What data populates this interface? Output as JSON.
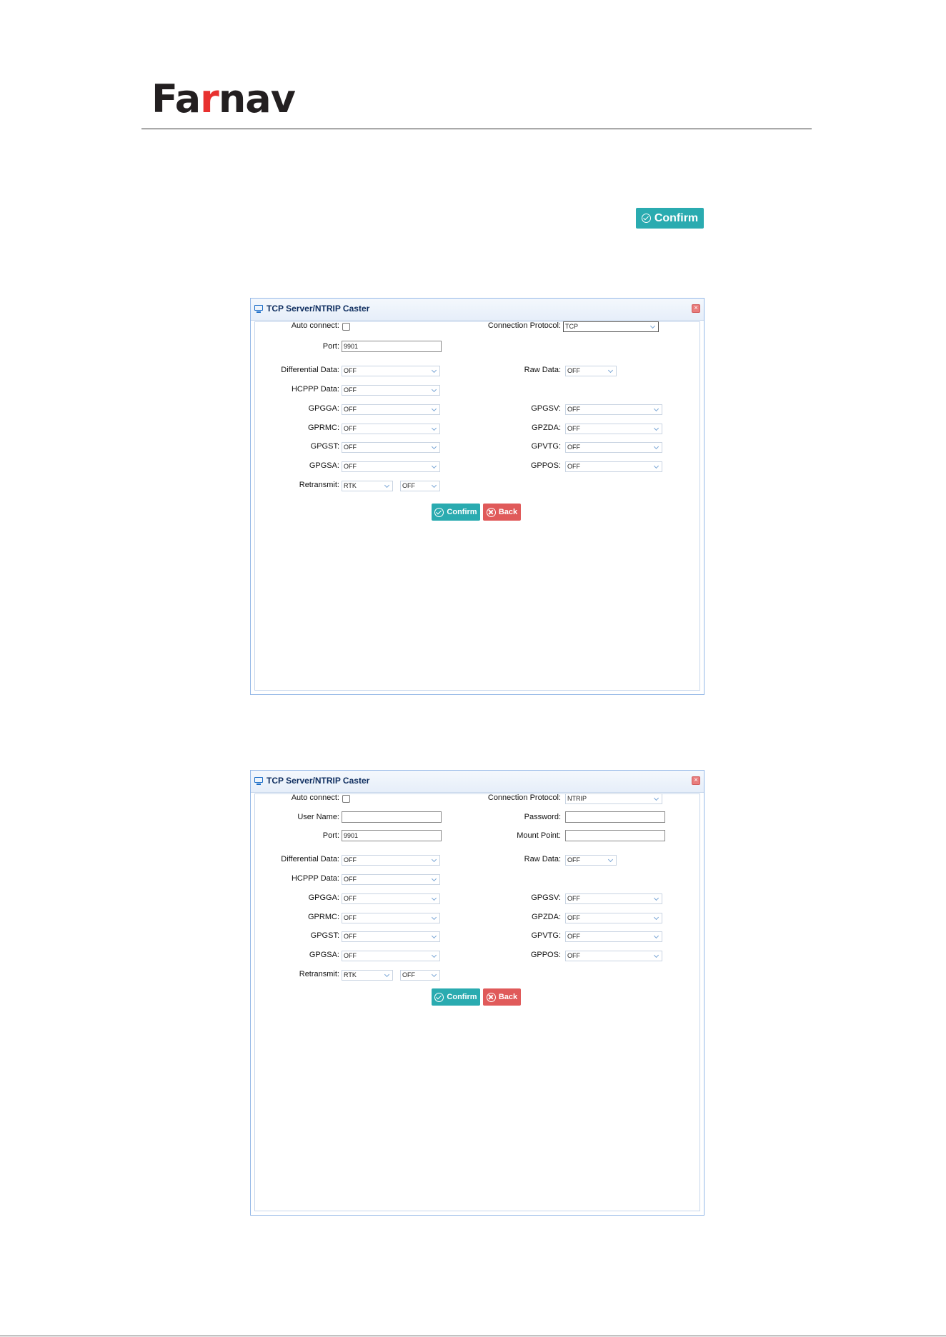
{
  "logo": {
    "part1": "Fa",
    "part2": "r",
    "part3": "nav"
  },
  "top_confirm": {
    "label": "Confirm"
  },
  "dialog1": {
    "title": "TCP Server/NTRIP Caster",
    "auto_connect_label": "Auto connect:",
    "protocol_label": "Connection Protocol:",
    "protocol_value": "TCP",
    "port_label": "Port:",
    "port_value": "9901",
    "diff_label": "Differential Data:",
    "diff_value": "OFF",
    "raw_label": "Raw Data:",
    "raw_value": "OFF",
    "hcppp_label": "HCPPP Data:",
    "hcppp_value": "OFF",
    "gpgga_label": "GPGGA:",
    "gpgga_value": "OFF",
    "gpgsv_label": "GPGSV:",
    "gpgsv_value": "OFF",
    "gprmc_label": "GPRMC:",
    "gprmc_value": "OFF",
    "gpzda_label": "GPZDA:",
    "gpzda_value": "OFF",
    "gpgst_label": "GPGST:",
    "gpgst_value": "OFF",
    "gpvtg_label": "GPVTG:",
    "gpvtg_value": "OFF",
    "gpgsa_label": "GPGSA:",
    "gpgsa_value": "OFF",
    "gppos_label": "GPPOS:",
    "gppos_value": "OFF",
    "retransmit_label": "Retransmit:",
    "retransmit_value1": "RTK",
    "retransmit_value2": "OFF",
    "confirm_label": "Confirm",
    "back_label": "Back"
  },
  "dialog2": {
    "title": "TCP Server/NTRIP Caster",
    "auto_connect_label": "Auto connect:",
    "protocol_label": "Connection Protocol:",
    "protocol_value": "NTRIP",
    "username_label": "User Name:",
    "username_value": "",
    "password_label": "Password:",
    "password_value": "",
    "port_label": "Port:",
    "port_value": "9901",
    "mount_label": "Mount Point:",
    "mount_value": "",
    "diff_label": "Differential Data:",
    "diff_value": "OFF",
    "raw_label": "Raw Data:",
    "raw_value": "OFF",
    "hcppp_label": "HCPPP Data:",
    "hcppp_value": "OFF",
    "gpgga_label": "GPGGA:",
    "gpgga_value": "OFF",
    "gpgsv_label": "GPGSV:",
    "gpgsv_value": "OFF",
    "gprmc_label": "GPRMC:",
    "gprmc_value": "OFF",
    "gpzda_label": "GPZDA:",
    "gpzda_value": "OFF",
    "gpgst_label": "GPGST:",
    "gpgst_value": "OFF",
    "gpvtg_label": "GPVTG:",
    "gpvtg_value": "OFF",
    "gpgsa_label": "GPGSA:",
    "gpgsa_value": "OFF",
    "gppos_label": "GPPOS:",
    "gppos_value": "OFF",
    "retransmit_label": "Retransmit:",
    "retransmit_value1": "RTK",
    "retransmit_value2": "OFF",
    "confirm_label": "Confirm",
    "back_label": "Back"
  },
  "colors": {
    "brand_dark": "#231f20",
    "brand_red": "#e8312f",
    "confirm": "#2aabb0",
    "back": "#e05a5a",
    "dialog_border": "#95b8e7"
  }
}
